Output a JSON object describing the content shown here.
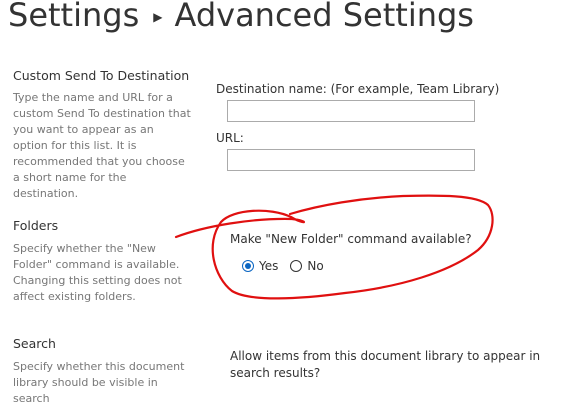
{
  "header": {
    "breadcrumb_parent": "Settings",
    "breadcrumb_current": "Advanced Settings"
  },
  "send_to": {
    "heading": "Custom Send To Destination",
    "description": "Type the name and URL for a custom Send To destination that you want to appear as an option for this list. It is recommended that you choose a short name for the destination.",
    "name_label": "Destination name: (For example, Team Library)",
    "name_value": "",
    "url_label": "URL:",
    "url_value": ""
  },
  "folders": {
    "heading": "Folders",
    "description": "Specify whether the \"New Folder\" command is available. Changing this setting does not affect existing folders.",
    "question": "Make \"New Folder\" command available?",
    "options": [
      "Yes",
      "No"
    ],
    "selected": "Yes"
  },
  "search": {
    "heading": "Search",
    "description": "Specify whether this document library should be visible in search",
    "question": "Allow items from this document library to appear in search results?"
  },
  "colors": {
    "radio_accent": "#0b66c2",
    "annotation": "#e01010"
  },
  "icons": {
    "breadcrumb_separator": "breadcrumb-arrow-icon"
  }
}
